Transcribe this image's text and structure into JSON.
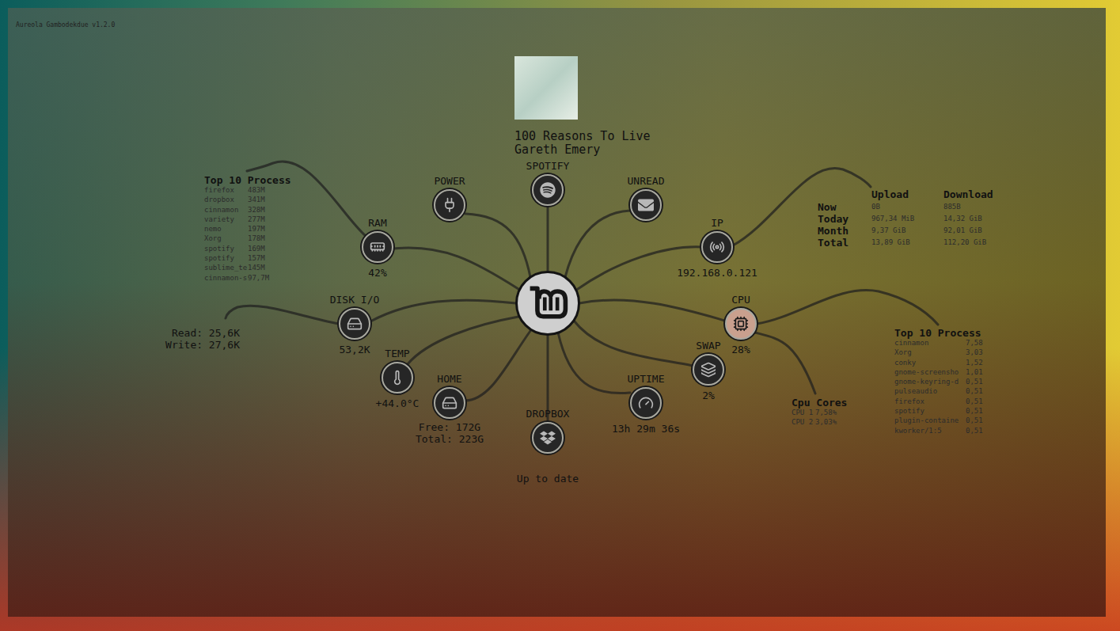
{
  "conky": {
    "version": "Aureola Gambodekdue v1.2.0"
  },
  "now_playing": {
    "title": "100 Reasons To Live",
    "artist": "Gareth Emery"
  },
  "nodes": [
    {
      "label": "SPOTIFY",
      "values": [],
      "alert": false
    },
    {
      "label": "POWER",
      "values": [],
      "alert": false
    },
    {
      "label": "UNREAD",
      "values": [],
      "alert": false
    },
    {
      "label": "RAM",
      "values": [
        "42%"
      ],
      "alert": false
    },
    {
      "label": "IP",
      "values": [
        "192.168.0.121"
      ],
      "alert": false
    },
    {
      "label": "DISK I/O",
      "values": [
        "53,2K"
      ],
      "alert": false
    },
    {
      "label": "CPU",
      "values": [
        "28%"
      ],
      "alert": true
    },
    {
      "label": "TEMP",
      "values": [
        "+44.0°C"
      ],
      "alert": false
    },
    {
      "label": "SWAP",
      "values": [
        "2%"
      ],
      "alert": false
    },
    {
      "label": "HOME",
      "values": [
        "Free: 172G",
        "Total: 223G"
      ],
      "alert": false
    },
    {
      "label": "UPTIME",
      "values": [
        "13h 29m 36s"
      ],
      "alert": false
    },
    {
      "label": "DROPBOX",
      "values": [
        "Up to date"
      ],
      "alert": false
    }
  ],
  "memory_processes": {
    "title": "Top 10 Process",
    "rows": [
      {
        "name": "firefox",
        "value": "483M"
      },
      {
        "name": "dropbox",
        "value": "341M"
      },
      {
        "name": "cinnamon",
        "value": "328M"
      },
      {
        "name": "variety",
        "value": "277M"
      },
      {
        "name": "nemo",
        "value": "197M"
      },
      {
        "name": "Xorg",
        "value": "178M"
      },
      {
        "name": "spotify",
        "value": "169M"
      },
      {
        "name": "spotify",
        "value": "157M"
      },
      {
        "name": "sublime_te",
        "value": "145M"
      },
      {
        "name": "cinnamon-s",
        "value": "97,7M"
      }
    ]
  },
  "disk_io": {
    "read": "Read: 25,6K",
    "write": "Write: 27,6K"
  },
  "network": {
    "columns": [
      "Upload",
      "Download"
    ],
    "rows": [
      {
        "label": "Now",
        "upload": "0B",
        "download": "885B"
      },
      {
        "label": "Today",
        "upload": "967,34 MiB",
        "download": "14,32 GiB"
      },
      {
        "label": "Month",
        "upload": "9,37 GiB",
        "download": "92,01 GiB"
      },
      {
        "label": "Total",
        "upload": "13,89 GiB",
        "download": "112,20 GiB"
      }
    ]
  },
  "cpu_cores": {
    "title": "Cpu Cores",
    "rows": [
      {
        "name": "CPU 1",
        "value": "7,58%"
      },
      {
        "name": "CPU 2",
        "value": "3,03%"
      }
    ]
  },
  "cpu_processes": {
    "title": "Top 10 Process",
    "rows": [
      {
        "name": "cinnamon",
        "value": "7,58"
      },
      {
        "name": "Xorg",
        "value": "3,03"
      },
      {
        "name": "conky",
        "value": "1,52"
      },
      {
        "name": "gnome-screensho",
        "value": "1,01"
      },
      {
        "name": "gnome-keyring-d",
        "value": "0,51"
      },
      {
        "name": "pulseaudio",
        "value": "0,51"
      },
      {
        "name": "firefox",
        "value": "0,51"
      },
      {
        "name": "spotify",
        "value": "0,51"
      },
      {
        "name": "plugin-containe",
        "value": "0,51"
      },
      {
        "name": "kworker/1:5",
        "value": "0,51"
      }
    ]
  }
}
